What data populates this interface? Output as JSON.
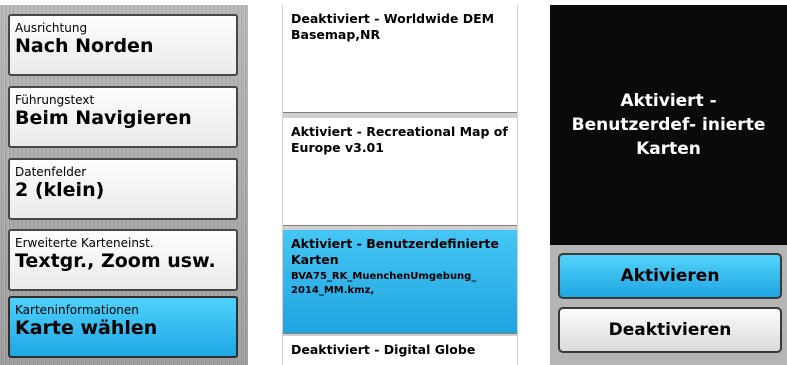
{
  "settings_menu": {
    "items": [
      {
        "label": "Ausrichtung",
        "value": "Nach Norden"
      },
      {
        "label": "Führungstext",
        "value": "Beim Navigieren"
      },
      {
        "label": "Datenfelder",
        "value": "2 (klein)"
      },
      {
        "label": "Erweiterte Karteneinst.",
        "value": "Textgr., Zoom usw."
      },
      {
        "label": "Karteninformationen",
        "value": "Karte wählen"
      }
    ],
    "selected_index": 4
  },
  "map_list": {
    "rows": [
      {
        "title": "Deaktiviert - Worldwide DEM Basemap,NR",
        "subtitle": ""
      },
      {
        "title": "Aktiviert - Recreational Map of  Europe v3.01",
        "subtitle": ""
      },
      {
        "title": "Aktiviert - Benutzerdefinierte Karten",
        "subtitle": "BVA75_RK_MuenchenUmgebung_ 2014_MM.kmz,"
      },
      {
        "title": "Deaktiviert - Digital Globe",
        "subtitle": ""
      }
    ],
    "selected_index": 2
  },
  "dialog": {
    "message": "Aktiviert - Benutzerdef- inierte Karten",
    "activate_label": "Aktivieren",
    "deactivate_label": "Deaktivieren"
  },
  "colors": {
    "selection_blue": "#1ea7e3",
    "dialog_background": "#0a0a0a"
  }
}
